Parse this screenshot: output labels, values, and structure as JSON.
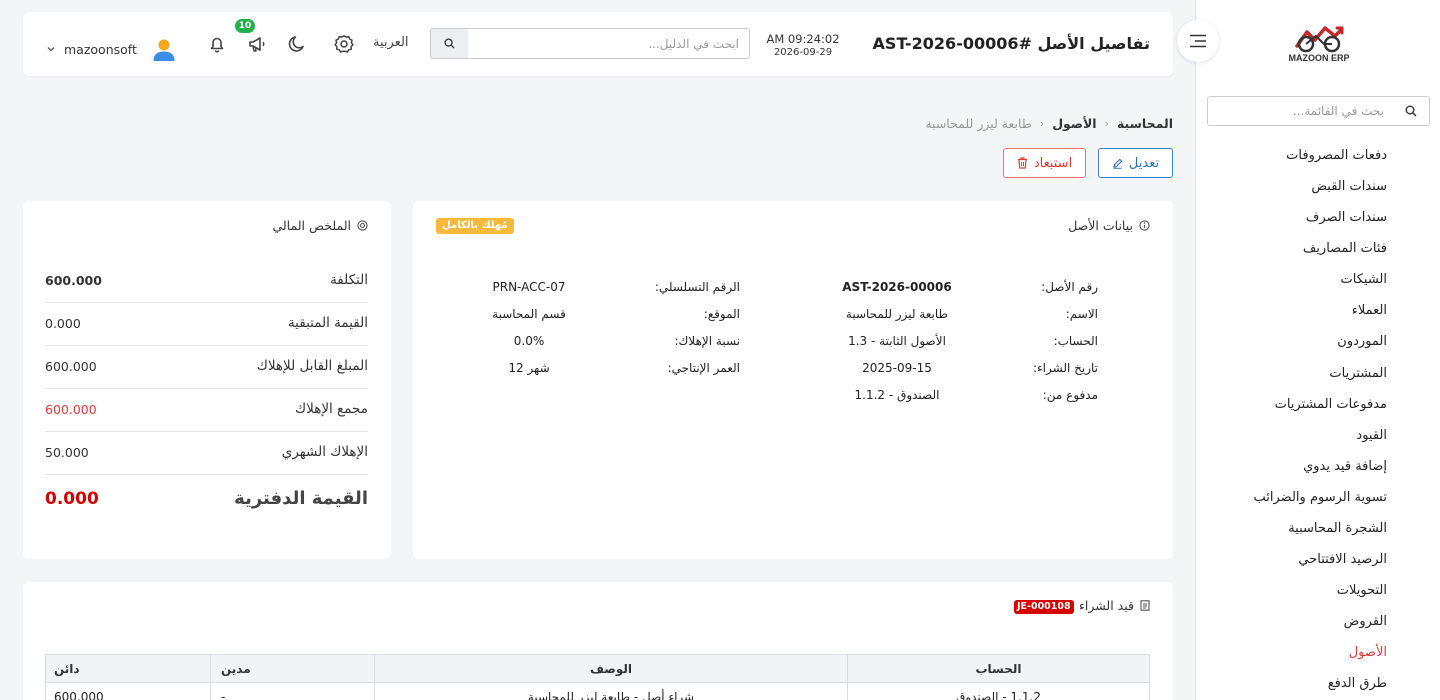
{
  "sidebar": {
    "logo_text": "MAZOON ERP",
    "search_placeholder": "بحث في القائمة...",
    "items": [
      {
        "label": "دفعات المصروفات"
      },
      {
        "label": "سندات القبض"
      },
      {
        "label": "سندات الصرف"
      },
      {
        "label": "فئات المصاريف"
      },
      {
        "label": "الشيكات"
      },
      {
        "label": "العملاء"
      },
      {
        "label": "الموردون"
      },
      {
        "label": "المشتريات"
      },
      {
        "label": "مدفوعات المشتريات"
      },
      {
        "label": "القيود"
      },
      {
        "label": "إضافة قيد يدوي"
      },
      {
        "label": "تسوية الرسوم والضرائب"
      },
      {
        "label": "الشجرة المحاسبية"
      },
      {
        "label": "الرصيد الافتتاحي"
      },
      {
        "label": "التحويلات"
      },
      {
        "label": "القروض"
      },
      {
        "label": "الأصول",
        "active": true
      },
      {
        "label": "طرق الدفع"
      }
    ]
  },
  "header": {
    "title": "تفاصيل الأصل #AST-2026-00006",
    "time": "AM 09:24:02",
    "date": "2026-09-29",
    "search_placeholder": "ابحث في الدليل...",
    "language": "العربية",
    "notification_count": "10",
    "username": "mazoonsoft"
  },
  "breadcrumb": {
    "items": [
      "المحاسبة",
      "الأصول",
      "طابعة ليزر للمحاسبة"
    ]
  },
  "actions": {
    "edit_label": "تعديل",
    "exclude_label": "استبعاد"
  },
  "asset_card": {
    "title": "بيانات الأصل",
    "status_badge": "مُهلك بالكامل",
    "fields": {
      "asset_no_label": "رقم الأصل:",
      "asset_no": "AST-2026-00006",
      "name_label": "الاسم:",
      "name": "طابعة ليزر للمحاسبة",
      "account_label": "الحساب:",
      "account": "1.3 - الأصول الثابتة",
      "purchase_date_label": "تاريخ الشراء:",
      "purchase_date": "2025-09-15",
      "paid_from_label": "مدفوع من:",
      "paid_from": "1.1.2 - الصندوق",
      "serial_label": "الرقم التسلسلي:",
      "serial": "PRN-ACC-07",
      "location_label": "الموقع:",
      "location": "قسم المحاسبة",
      "dep_rate_label": "نسبة الإهلاك:",
      "dep_rate": "0.0%",
      "life_label": "العمر الإنتاجي:",
      "life": "12 شهر"
    }
  },
  "summary_card": {
    "title": "الملخص المالي",
    "rows": [
      {
        "label": "التكلفة",
        "value": "600.000"
      },
      {
        "label": "القيمة المتبقية",
        "value": "0.000"
      },
      {
        "label": "المبلغ القابل للإهلاك",
        "value": "600.000"
      },
      {
        "label": "مجمع الإهلاك",
        "value": "600.000"
      },
      {
        "label": "الإهلاك الشهري",
        "value": "50.000"
      }
    ],
    "book_value_label": "القيمة الدفترية",
    "book_value": "0.000"
  },
  "journal_card": {
    "title": "قيد الشراء",
    "badge": "JE-000108",
    "columns": [
      "الحساب",
      "الوصف",
      "مدين",
      "دائن"
    ],
    "rows": [
      {
        "account": "1.1.2 - الصندوق",
        "description": "شراء أصل - طابعة ليزر للمحاسبة",
        "debit": "-",
        "credit": "600.000"
      }
    ]
  },
  "colors": {
    "accent_blue": "#2a72b8",
    "danger_red": "#e53935",
    "book_value_red": "#d50000",
    "badge_yellow": "#f6b93b",
    "notification_green": "#21b04b"
  }
}
